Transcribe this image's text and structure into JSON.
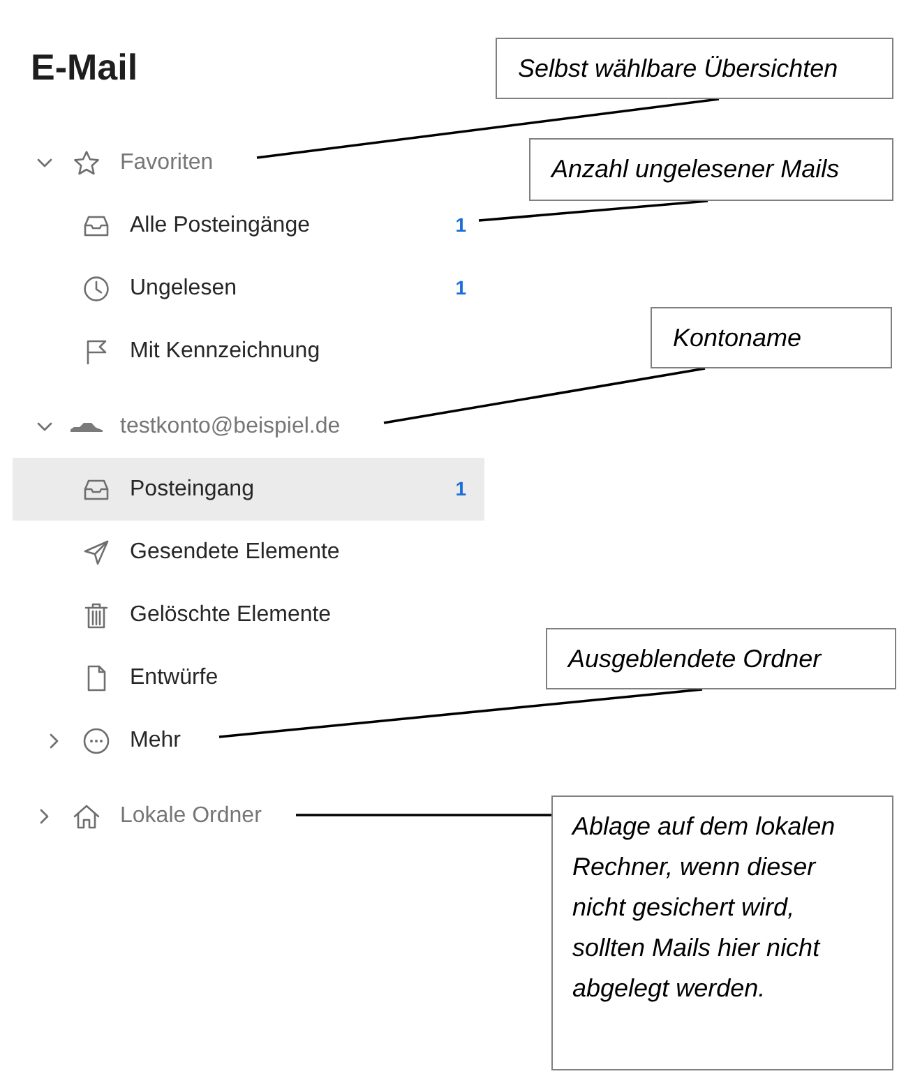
{
  "title": "E-Mail",
  "tree": [
    {
      "kind": "favorites",
      "label": "Favoriten",
      "expanded": true,
      "children": [
        {
          "kind": "inbox",
          "label": "Alle Posteingänge",
          "unread": "1",
          "selected": false
        },
        {
          "kind": "unread",
          "label": "Ungelesen",
          "unread": "1",
          "selected": false
        },
        {
          "kind": "flagged",
          "label": "Mit Kennzeichnung",
          "selected": false
        }
      ]
    },
    {
      "kind": "account",
      "label": "testkonto@beispiel.de",
      "expanded": true,
      "children": [
        {
          "kind": "inbox",
          "label": "Posteingang",
          "unread": "1",
          "selected": true
        },
        {
          "kind": "sent",
          "label": "Gesendete Elemente",
          "selected": false
        },
        {
          "kind": "trash",
          "label": "Gelöschte Elemente",
          "selected": false
        },
        {
          "kind": "drafts",
          "label": "Entwürfe",
          "selected": false
        },
        {
          "kind": "more",
          "label": "Mehr",
          "expanded": false,
          "selected": false
        }
      ]
    },
    {
      "kind": "local",
      "label": "Lokale Ordner",
      "expanded": false
    }
  ],
  "annotations": [
    {
      "text": "Selbst wählbare Übersichten"
    },
    {
      "text": "Anzahl ungelesener Mails"
    },
    {
      "text": "Kontoname"
    },
    {
      "text": "Ausgeblendete Ordner"
    },
    {
      "text": "Ablage auf dem lokalen Rechner, wenn dieser nicht gesichert wird, sollten Mails hier nicht abgelegt werden."
    }
  ]
}
